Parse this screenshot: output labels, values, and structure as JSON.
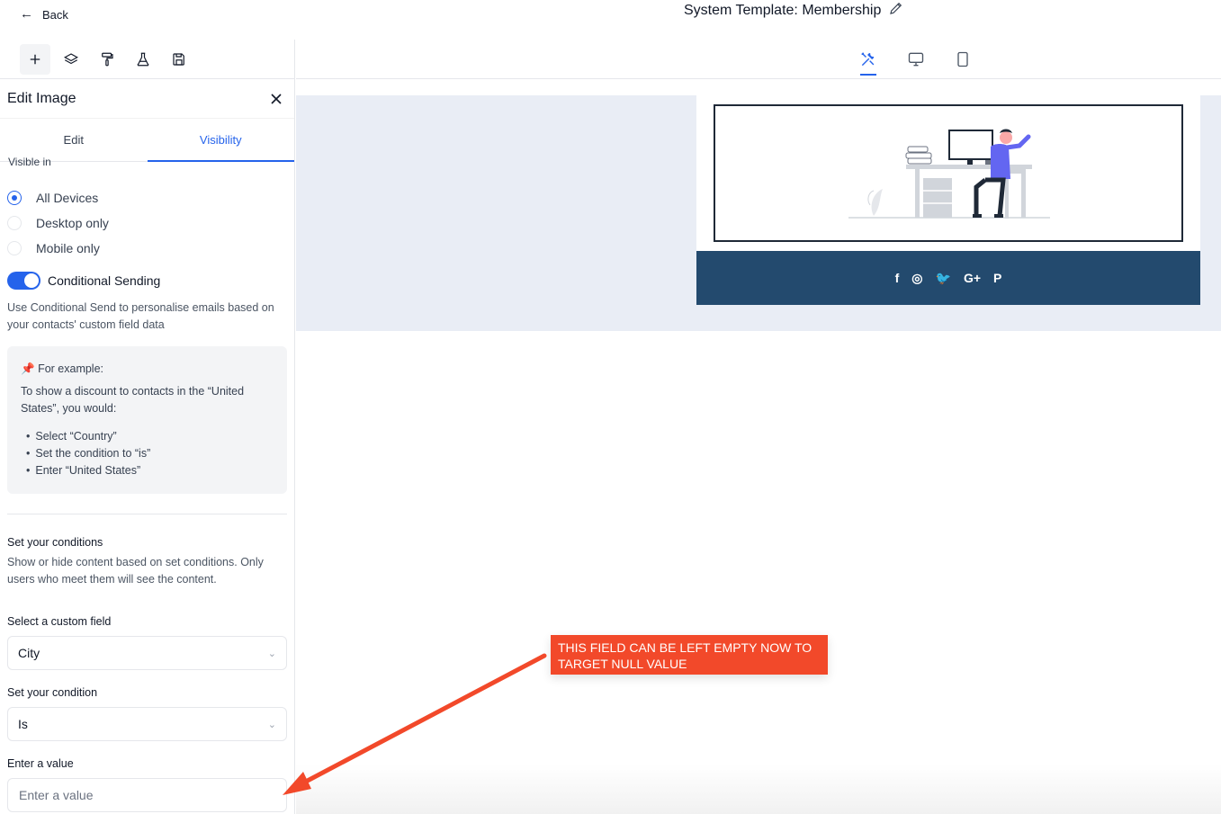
{
  "header": {
    "back_label": "Back",
    "title": "System Template: Membership"
  },
  "toolbar": {
    "tools": [
      "plus-icon",
      "layers-icon",
      "paint-roller-icon",
      "flask-icon",
      "save-icon"
    ]
  },
  "panel": {
    "title": "Edit Image",
    "tabs": [
      "Edit",
      "Visibility"
    ],
    "active_tab": "Visibility",
    "visible_in_label": "Visible in",
    "radios": [
      {
        "label": "All Devices",
        "checked": true
      },
      {
        "label": "Desktop only",
        "checked": false
      },
      {
        "label": "Mobile only",
        "checked": false
      }
    ],
    "conditional": {
      "label": "Conditional Sending",
      "enabled": true,
      "description": "Use Conditional Send to personalise emails based on your contacts' custom field data"
    },
    "example": {
      "heading": "For example:",
      "intro": "To show a discount to contacts in the “United States”, you would:",
      "steps": [
        "Select “Country”",
        "Set the condition to “is”",
        "Enter “United States”"
      ]
    },
    "conditions": {
      "title": "Set your conditions",
      "description": "Show or hide content based on set conditions. Only users who meet them will see the content.",
      "custom_field_label": "Select a custom field",
      "custom_field_value": "City",
      "condition_label": "Set your condition",
      "condition_value": "Is",
      "value_label": "Enter a value",
      "value_placeholder": "Enter a value"
    }
  },
  "canvas": {
    "views": [
      "tools-icon",
      "desktop-icon",
      "mobile-icon"
    ],
    "active_view": "tools-icon",
    "social_icons": [
      "f",
      "◎",
      "🐦",
      "G+",
      "P"
    ]
  },
  "callout": {
    "text": "THIS FIELD CAN BE LEFT EMPTY NOW TO TARGET NULL VALUE",
    "color": "#f2492a"
  }
}
